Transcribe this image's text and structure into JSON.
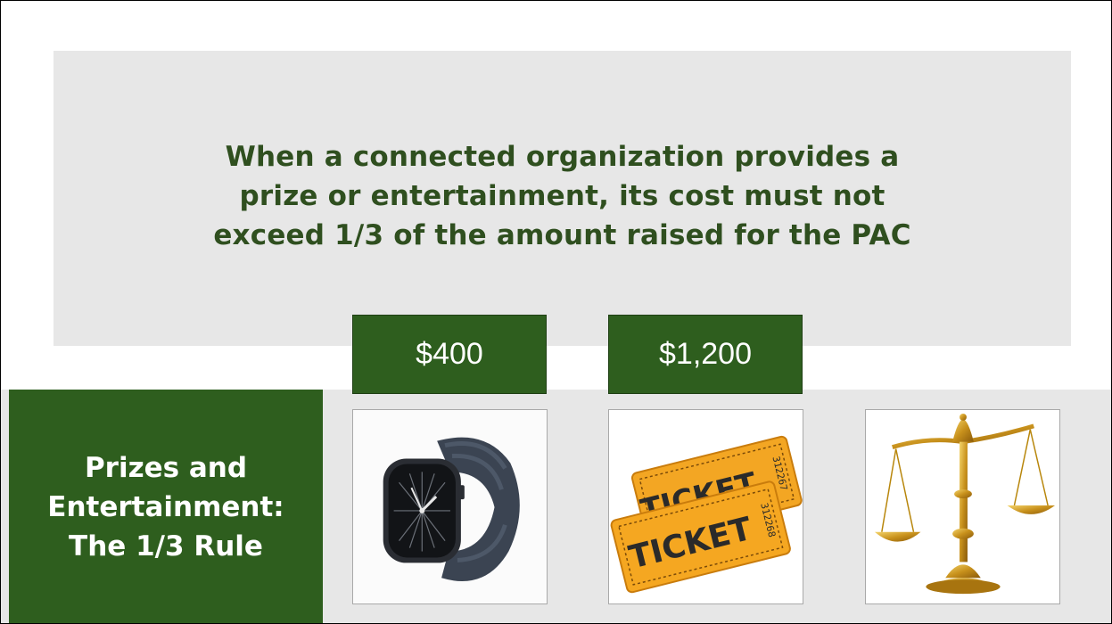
{
  "headline": "When a connected organization provides a\nprize or entertainment, its cost must not\nexceed 1/3 of the amount raised for the PAC",
  "side_title": "Prizes and\nEntertainment:\nThe 1/3 Rule",
  "prices": {
    "watch": "$400",
    "tickets": "$1,200"
  },
  "images": {
    "watch": {
      "icon": "smartwatch-icon"
    },
    "tickets": {
      "icon": "ticket-icon",
      "ticket_label": "TICKET",
      "serial_front": "312268",
      "serial_back": "312267"
    },
    "scales": {
      "icon": "scales-of-justice-icon"
    }
  },
  "colors": {
    "dark_green": "#2e5e1e",
    "headline_text": "#2f4f1f",
    "panel_gray": "#e7e7e7"
  }
}
